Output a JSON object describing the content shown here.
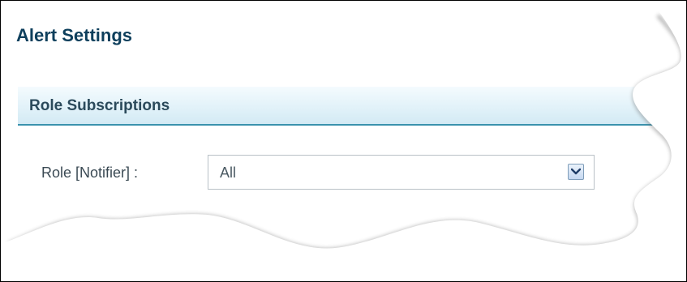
{
  "page": {
    "title": "Alert Settings"
  },
  "section": {
    "title": "Role Subscriptions"
  },
  "role_field": {
    "label": "Role [Notifier] :",
    "selected_value": "All",
    "arrow_icon": "chevron-down-icon"
  },
  "colors": {
    "title_text": "#0e3f5c",
    "section_underline": "#3a92ad",
    "dropdown_arrow_border": "#7f9db9"
  }
}
